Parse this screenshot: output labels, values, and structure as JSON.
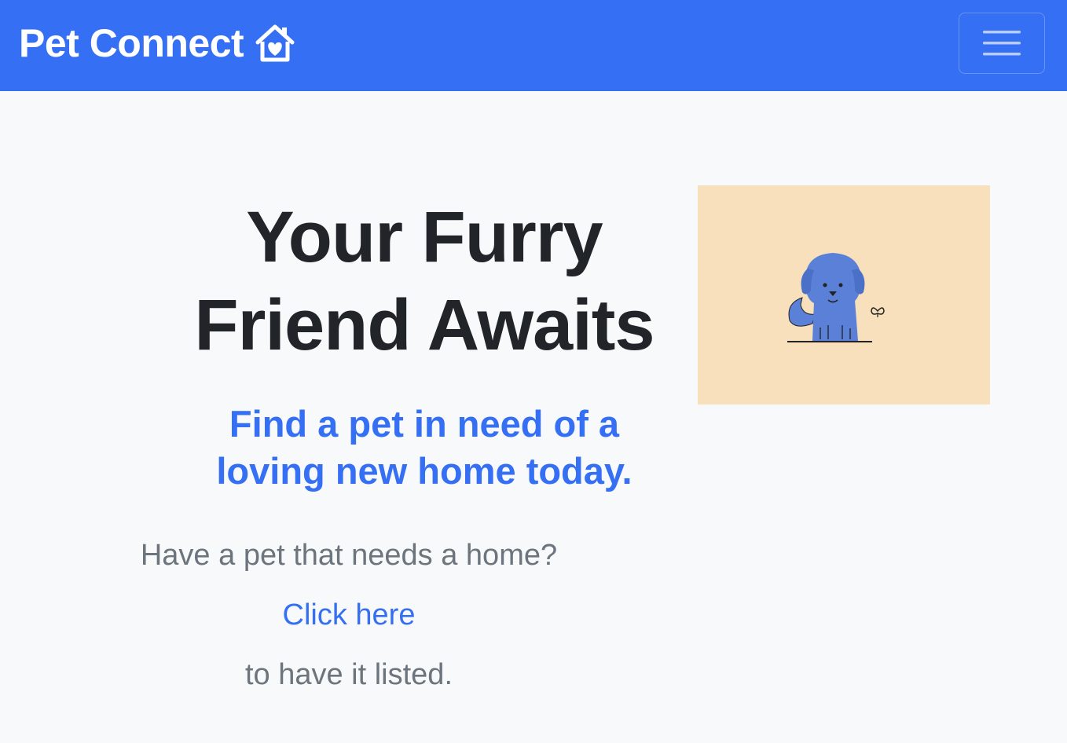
{
  "navbar": {
    "brand": "Pet Connect",
    "brand_icon": "house-heart-icon",
    "toggle_icon": "hamburger-menu-icon",
    "background": "#356ff3"
  },
  "hero": {
    "title_line1": "Your Furry",
    "title_line2": "Friend Awaits",
    "subtitle_line1": "Find a pet in need of a",
    "subtitle_line2": "loving new home today.",
    "image_icon": "dog-illustration",
    "image_background": "#f7e0bb"
  },
  "cta": {
    "question": "Have a pet that needs a home?",
    "link_label": "Click here",
    "suffix": "to have it listed."
  },
  "colors": {
    "accent": "#356ff3",
    "heading": "#212529",
    "muted": "#6c757d",
    "page_bg": "#f8f9fa"
  }
}
